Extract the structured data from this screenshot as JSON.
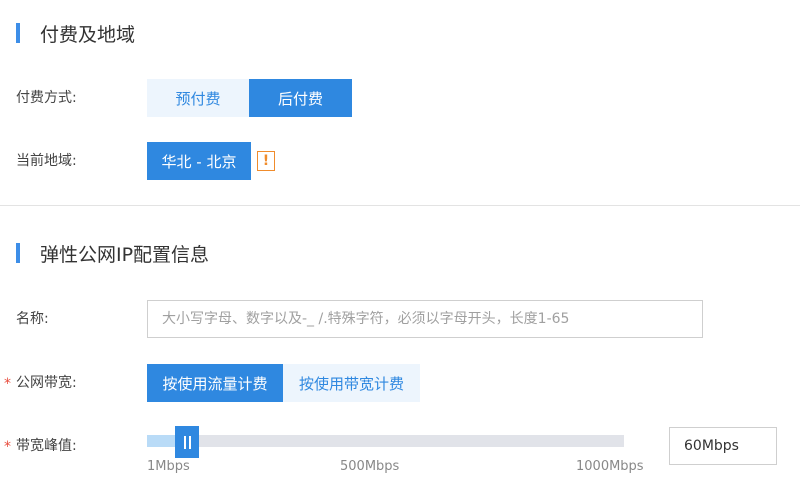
{
  "billing_section": {
    "title": "付费及地域",
    "payment_label": "付费方式:",
    "payment_options": [
      "预付费",
      "后付费"
    ],
    "payment_selected": "后付费",
    "region_label": "当前地域:",
    "region_value": "华北 - 北京",
    "warning_glyph": "!"
  },
  "eip_section": {
    "title": "弹性公网IP配置信息",
    "name_label": "名称:",
    "name_placeholder": "大小写字母、数字以及-_ /.特殊字符，必须以字母开头，长度1-65",
    "name_value": "",
    "required_mark": "*",
    "bandwidth_mode_label": "公网带宽:",
    "bandwidth_mode_options": [
      "按使用流量计费",
      "按使用带宽计费"
    ],
    "bandwidth_mode_selected": "按使用流量计费",
    "peak_label": "带宽峰值:",
    "slider": {
      "min_label": "1Mbps",
      "mid_label": "500Mbps",
      "max_label": "1000Mbps",
      "min": 1,
      "max": 1000,
      "value": 60
    },
    "peak_value": "60Mbps"
  },
  "colors": {
    "accent": "#2f88e0",
    "accent_light": "#edf5fd",
    "warning": "#f08c2c",
    "required": "#e84c3d"
  }
}
